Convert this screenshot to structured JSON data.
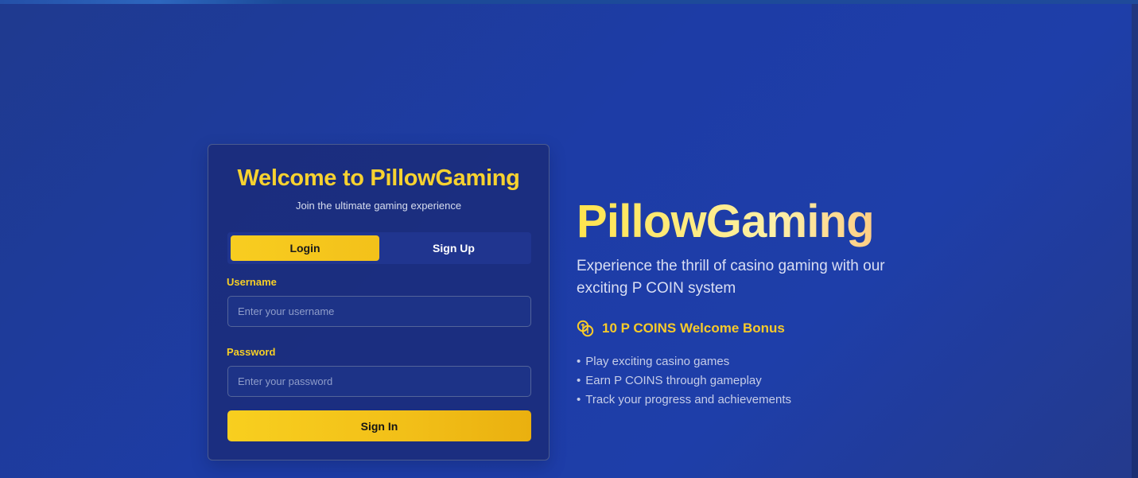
{
  "auth_card": {
    "title": "Welcome to PillowGaming",
    "subtitle": "Join the ultimate gaming experience",
    "tabs": [
      {
        "label": "Login",
        "active": true
      },
      {
        "label": "Sign Up",
        "active": false
      }
    ],
    "username": {
      "label": "Username",
      "placeholder": "Enter your username",
      "value": ""
    },
    "password": {
      "label": "Password",
      "placeholder": "Enter your password",
      "value": ""
    },
    "submit_label": "Sign In"
  },
  "hero": {
    "brand": "PillowGaming",
    "description": "Experience the thrill of casino gaming with our exciting P COIN system",
    "bonus_icon": "coin-icon",
    "bonus_text": "10 P COINS Welcome Bonus",
    "features": [
      "Play exciting casino games",
      "Earn P COINS through gameplay",
      "Track your progress and achievements"
    ],
    "bullet": "•"
  },
  "colors": {
    "accent_yellow": "#f7d230",
    "button_yellow": "#f2bf18",
    "background_blue": "#1d3ca6",
    "card_blue": "#1b2b78",
    "hero_gradient_end": "#ffb067"
  }
}
